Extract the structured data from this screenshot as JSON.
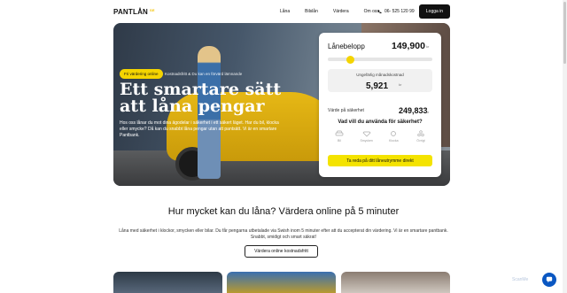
{
  "nav": {
    "logo": "PANTLÅN",
    "logo_sub": "SE",
    "links": [
      "Låna",
      "Bilslån",
      "Värdera",
      "Om oss"
    ],
    "phone": "06- 525 120 99",
    "login": "Logga in"
  },
  "hero": {
    "badge": "Fri värdering online",
    "badge_sub": "Kostnadsfritt & Du kan en förvärd lämnande",
    "title": "Ett smartare sätt att låna pengar",
    "text": "Hos oss lånar du mot dina ägodelar i säkerhet i ett säkert läget. Har du bil, klocka eller smycke? Då kan du snabbt låna pengar utan att pantsätt. Vi är en smartare Pantbank.",
    "colors": {
      "accent": "#f4d400"
    }
  },
  "calculator": {
    "loan_label": "Lånebelopp",
    "loan_amount": "149,900",
    "currency": "kr",
    "slider_fraction": 0.22,
    "monthly_label": "Ungefärlig månadskostnad",
    "monthly_amount": "5,921",
    "pledge_label": "Värde på säkerhet",
    "pledge_amount": "249,833",
    "question": "Vad vill du använda för säkerhet?",
    "categories": [
      "Bil",
      "Smycken",
      "Klocka",
      "Övrigt"
    ],
    "cta": "Ta reda på ditt låneutrymme direkt"
  },
  "section": {
    "title": "Hur mycket kan du låna? Värdera online på 5 minuter",
    "text": "Låna med säkerhet i klockor, smycken eller bilar. Du får pengarna utbetalade via Swish inom 5 minuter efter att du accepterat din värdering. Vi är en smartare pantbank. Snabbt, smidigt och smart säkrat!",
    "button": "Värdera online kostnadsfritt"
  },
  "watermark": "ScanMe"
}
